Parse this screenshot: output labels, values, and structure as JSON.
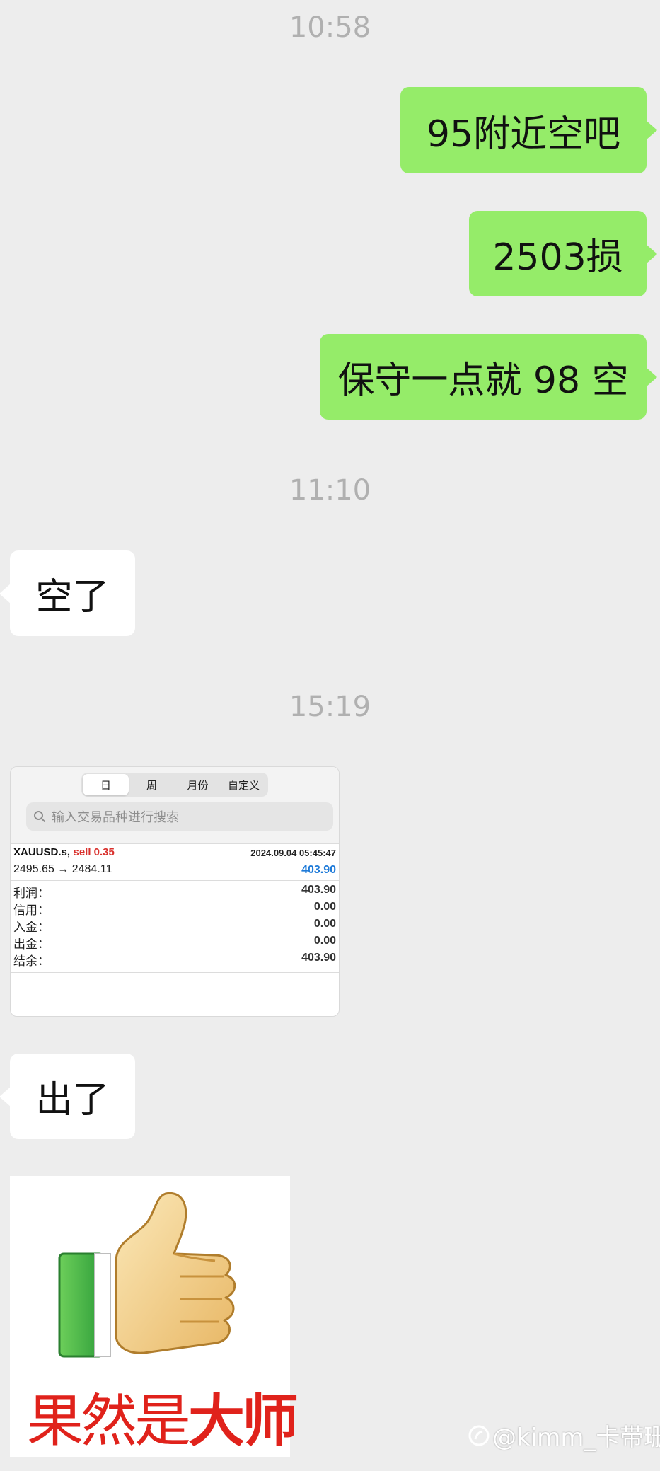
{
  "chat": {
    "time1": "10:58",
    "msg1": "95附近空吧",
    "msg2": "2503损",
    "msg3": "保守一点就 98 空",
    "time2": "11:10",
    "msg4": "空了",
    "time3": "15:19",
    "msg5": "出了"
  },
  "trade_screenshot": {
    "tabs": [
      "日",
      "周",
      "月份",
      "自定义"
    ],
    "active_tab": "日",
    "search_placeholder": "输入交易品种进行搜索",
    "symbol": "XAUUSD.s,",
    "side": "sell 0.35",
    "datetime": "2024.09.04 05:45:47",
    "price_move": "2495.65 → 2484.11",
    "pnl": "403.90",
    "rows": [
      {
        "label": "利润：",
        "value": "403.90"
      },
      {
        "label": "信用：",
        "value": "0.00"
      },
      {
        "label": "入金：",
        "value": "0.00"
      },
      {
        "label": "出金：",
        "value": "0.00"
      },
      {
        "label": "结余：",
        "value": "403.90"
      }
    ]
  },
  "sticker": {
    "text_regular": "果然是",
    "text_bold": "大师",
    "colors": {
      "text": "#e0221b",
      "cuff": "#39b54a",
      "hand": "#f1d28a"
    }
  },
  "watermark": "@kimm_卡带珊",
  "colors": {
    "background": "#ededed",
    "outgoing_bubble": "#95ec69",
    "incoming_bubble": "#ffffff",
    "timestamp": "#b0b0b0"
  }
}
